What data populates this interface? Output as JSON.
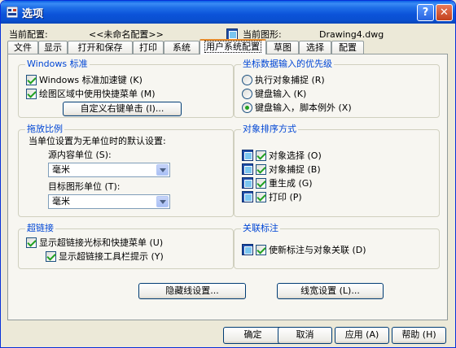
{
  "window": {
    "title": "选项",
    "help_glyph": "?",
    "close_glyph": "✕"
  },
  "header": {
    "profile_label": "当前配置:",
    "profile_value": "<<未命名配置>>",
    "drawing_label": "当前图形:",
    "drawing_value": "Drawing4.dwg"
  },
  "tabs": [
    "文件",
    "显示",
    "打开和保存",
    "打印",
    "系统",
    "用户系统配置",
    "草图",
    "选择",
    "配置"
  ],
  "active_tab": "用户系统配置",
  "windows_std": {
    "title": "Windows 标准",
    "accel_keys": "Windows 标准加速键 (K)",
    "shortcut_menus": "绘图区域中使用快捷菜单 (M)",
    "right_click_btn": "自定义右键单击 (I)..."
  },
  "coord_priority": {
    "title": "坐标数据输入的优先级",
    "opt1": "执行对象捕捉 (R)",
    "opt2": "键盘输入 (K)",
    "opt3": "键盘输入，脚本例外 (X)"
  },
  "insert_scale": {
    "title": "拖放比例",
    "desc": "当单位设置为无单位时的默认设置:",
    "source_label": "源内容单位 (S):",
    "source_value": "毫米",
    "target_label": "目标图形单位 (T):",
    "target_value": "毫米"
  },
  "object_sort": {
    "title": "对象排序方式",
    "items": [
      "对象选择 (O)",
      "对象捕捉 (B)",
      "重生成 (G)",
      "打印 (P)"
    ]
  },
  "hyperlink": {
    "title": "超链接",
    "cursor_menu": "显示超链接光标和快捷菜单 (U)",
    "tooltip": "显示超链接工具栏提示 (Y)"
  },
  "assoc_dim": {
    "title": "关联标注",
    "make_assoc": "使新标注与对象关联 (D)"
  },
  "panel_buttons": {
    "hidden_line": "隐藏线设置...",
    "lineweight": "线宽设置 (L)..."
  },
  "footer": {
    "ok": "确定",
    "cancel": "取消",
    "apply": "应用 (A)",
    "help": "帮助 (H)"
  }
}
